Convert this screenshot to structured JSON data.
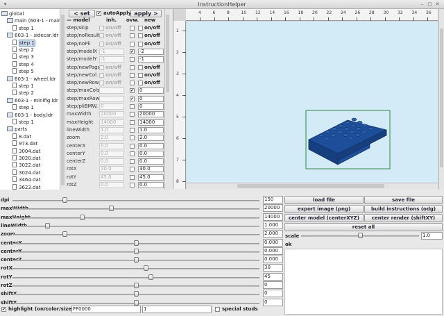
{
  "window": {
    "title": "InstructionHelper"
  },
  "tree": {
    "items": [
      {
        "label": "global",
        "kind": "folder",
        "indent": 0,
        "selected": false
      },
      {
        "label": "main (603-1 - main",
        "kind": "folder",
        "indent": 1,
        "selected": false
      },
      {
        "label": "step 1",
        "kind": "leaf",
        "indent": 2,
        "selected": false
      },
      {
        "label": "603-1 - sidecar.ldr",
        "kind": "folder",
        "indent": 1,
        "selected": false
      },
      {
        "label": "step 1",
        "kind": "leaf",
        "indent": 2,
        "selected": true
      },
      {
        "label": "step 2",
        "kind": "leaf",
        "indent": 2,
        "selected": false
      },
      {
        "label": "step 3",
        "kind": "leaf",
        "indent": 2,
        "selected": false
      },
      {
        "label": "step 4",
        "kind": "leaf",
        "indent": 2,
        "selected": false
      },
      {
        "label": "step 5",
        "kind": "leaf",
        "indent": 2,
        "selected": false
      },
      {
        "label": "603-1 - wheel.ldr",
        "kind": "folder",
        "indent": 1,
        "selected": false
      },
      {
        "label": "step 1",
        "kind": "leaf",
        "indent": 2,
        "selected": false
      },
      {
        "label": "step 2",
        "kind": "leaf",
        "indent": 2,
        "selected": false
      },
      {
        "label": "603-1 - minifig.ldr",
        "kind": "folder",
        "indent": 1,
        "selected": false
      },
      {
        "label": "step 1",
        "kind": "leaf",
        "indent": 2,
        "selected": false
      },
      {
        "label": "603-1 - body.ldr",
        "kind": "folder",
        "indent": 1,
        "selected": false
      },
      {
        "label": "step 1",
        "kind": "leaf",
        "indent": 2,
        "selected": false
      },
      {
        "label": "parts",
        "kind": "folder",
        "indent": 1,
        "selected": false
      },
      {
        "label": "8.dat",
        "kind": "leaf",
        "indent": 2,
        "selected": false
      },
      {
        "label": "973.dat",
        "kind": "leaf",
        "indent": 2,
        "selected": false
      },
      {
        "label": "3004.dat",
        "kind": "leaf",
        "indent": 2,
        "selected": false
      },
      {
        "label": "3020.dat",
        "kind": "leaf",
        "indent": 2,
        "selected": false
      },
      {
        "label": "3022.dat",
        "kind": "leaf",
        "indent": 2,
        "selected": false
      },
      {
        "label": "3024.dat",
        "kind": "leaf",
        "indent": 2,
        "selected": false
      },
      {
        "label": "3464.dat",
        "kind": "leaf",
        "indent": 2,
        "selected": false
      },
      {
        "label": "3623.dat",
        "kind": "leaf",
        "indent": 2,
        "selected": false
      }
    ]
  },
  "toolbar": {
    "set_label": "< set",
    "autoapply_label": "autoApply",
    "autoapply_checked": true,
    "apply_label": "apply >"
  },
  "params": {
    "headers": {
      "model": "model",
      "inh": "inh.",
      "ovw": "ovw.",
      "new": "new"
    },
    "onoff_label": "on/off",
    "rows": [
      {
        "name": "step/skip",
        "type": "bool",
        "ovw": false
      },
      {
        "name": "step/noResult",
        "type": "bool",
        "ovw": false
      },
      {
        "name": "step/noPli",
        "type": "bool",
        "ovw": false
      },
      {
        "name": "step/modelX",
        "type": "value",
        "inh": "-1",
        "ovw": true,
        "new": "-2"
      },
      {
        "name": "step/modelY",
        "type": "value",
        "inh": "-1",
        "ovw": false,
        "new": "-1"
      },
      {
        "name": "step/newPage",
        "type": "bool",
        "ovw": false
      },
      {
        "name": "step/newCol.",
        "type": "bool",
        "ovw": false
      },
      {
        "name": "step/newRow",
        "type": "bool",
        "ovw": false
      },
      {
        "name": "step/maxCols.",
        "type": "value",
        "inh": "",
        "ovw": true,
        "new": "0"
      },
      {
        "name": "step/maxRows",
        "type": "value",
        "inh": "",
        "ovw": true,
        "new": "0"
      },
      {
        "name": "step/pliBMW.",
        "type": "value",
        "inh": "0",
        "ovw": false,
        "new": "0"
      },
      {
        "name": "maxWidth",
        "type": "value",
        "inh": "20000",
        "ovw": false,
        "new": "20000"
      },
      {
        "name": "maxHeight",
        "type": "value",
        "inh": "14000",
        "ovw": false,
        "new": "14000"
      },
      {
        "name": "lineWidth",
        "type": "value",
        "inh": "1.0",
        "ovw": false,
        "new": "1.0"
      },
      {
        "name": "zoom",
        "type": "value",
        "inh": "2.0",
        "ovw": false,
        "new": "2.0"
      },
      {
        "name": "centerX",
        "type": "value",
        "inh": "0.0",
        "ovw": false,
        "new": "0.0"
      },
      {
        "name": "centerY",
        "type": "value",
        "inh": "0.0",
        "ovw": false,
        "new": "0.0"
      },
      {
        "name": "centerZ",
        "type": "value",
        "inh": "0.0",
        "ovw": false,
        "new": "0.0"
      },
      {
        "name": "rotX",
        "type": "value",
        "inh": "30.0",
        "ovw": false,
        "new": "30.0"
      },
      {
        "name": "rotY",
        "type": "value",
        "inh": "45.0",
        "ovw": false,
        "new": "45.0"
      },
      {
        "name": "rotZ",
        "type": "value",
        "inh": "0.0",
        "ovw": false,
        "new": "0.0"
      }
    ]
  },
  "viewer": {
    "background": "#d2ebf6",
    "brick_color": "#1d4e99",
    "top_ruler": [
      "4",
      "6",
      "8",
      "10",
      "12",
      "14",
      "16",
      "18",
      "20",
      "22",
      "24",
      "26",
      "28",
      "30",
      "32",
      "34",
      "36"
    ],
    "left_ruler": [
      "1",
      "2",
      "3",
      "4",
      "5",
      "6",
      "7",
      "8"
    ]
  },
  "sliders": [
    {
      "label": "dpi",
      "value": "150",
      "fraction": 0.21
    },
    {
      "label": "maxWidth",
      "value": "20000",
      "fraction": 0.4
    },
    {
      "label": "maxHeight",
      "value": "14000",
      "fraction": 0.28
    },
    {
      "label": "lineWidth",
      "value": "1.000",
      "fraction": 0.14
    },
    {
      "label": "zoom",
      "value": "2.000",
      "fraction": 0.21
    },
    {
      "label": "centerX",
      "value": "0.000",
      "fraction": 0.5
    },
    {
      "label": "centerY",
      "value": "0.000",
      "fraction": 0.5
    },
    {
      "label": "centerZ",
      "value": "0.000",
      "fraction": 0.5
    },
    {
      "label": "rotX",
      "value": "30",
      "fraction": 0.54
    },
    {
      "label": "rotY",
      "value": "45",
      "fraction": 0.56
    },
    {
      "label": "rotZ",
      "value": "0",
      "fraction": 0.5
    },
    {
      "label": "shiftX",
      "value": "0",
      "fraction": 0.5
    },
    {
      "label": "shiftY",
      "value": "0",
      "fraction": 0.5
    }
  ],
  "highlight": {
    "label": "highlight (on/color/size)",
    "checked": true,
    "color_value": "FF0000",
    "size_value": "1",
    "special_studs_label": "special studs",
    "special_studs_checked": false
  },
  "actions": {
    "load_file": "load file",
    "save_file": "save file",
    "export_image": "export image (png)",
    "build_instructions": "build instructions (odg)",
    "center_model": "center model (centerXYZ)",
    "center_render": "center render (shiftXY)",
    "reset_all": "reset all"
  },
  "scale": {
    "label": "scale",
    "value": "1.0",
    "fraction": 0.5
  },
  "status": {
    "text": "ok"
  }
}
